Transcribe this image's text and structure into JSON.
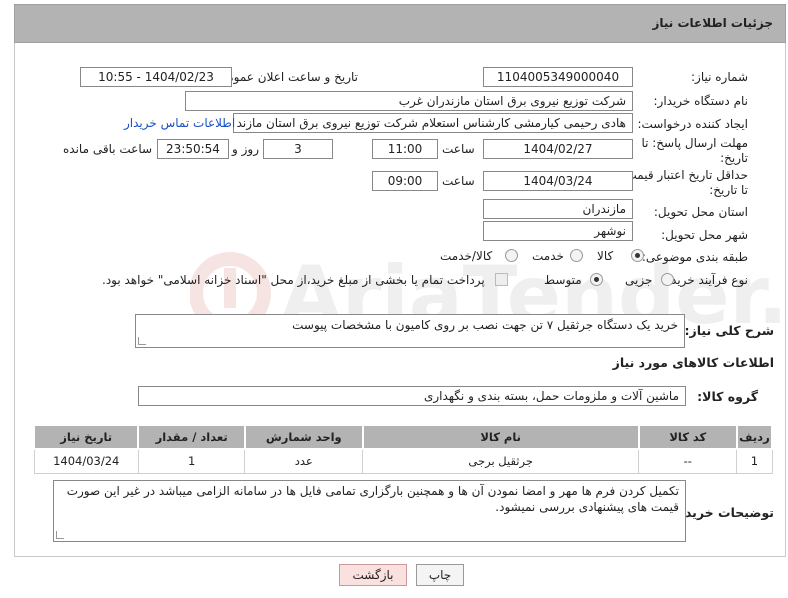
{
  "header": {
    "title": "جزئیات اطلاعات نیاز"
  },
  "form": {
    "need_number_label": "شماره نیاز:",
    "need_number": "1104005349000040",
    "announce_label": "تاریخ و ساعت اعلان عمومی:",
    "announce_value": "1404/02/23 - 10:55",
    "buyer_org_label": "نام دستگاه خریدار:",
    "buyer_org": "شرکت توزیع نیروی برق استان مازندران غرب",
    "creator_label": "ایجاد کننده درخواست:",
    "creator": "هادی رحیمی کیارمشی کارشناس استعلام شرکت توزیع نیروی برق استان مازند",
    "contact_link": "اطلاعات تماس خریدار",
    "deadline_label_1": "مهلت ارسال پاسخ: تا",
    "deadline_label_2": "تاریخ:",
    "deadline_date": "1404/02/27",
    "time_label": "ساعت",
    "deadline_time": "11:00",
    "days_value": "3",
    "days_label": "روز و",
    "remaining_time": "23:50:54",
    "remaining_label": "ساعت باقی مانده",
    "validity_label_1": "حداقل تاریخ اعتبار قیمت:",
    "validity_label_2": "تا تاریخ:",
    "validity_date": "1404/03/24",
    "validity_time_label": "ساعت",
    "validity_time": "09:00",
    "province_label": "استان محل تحویل:",
    "province": "مازندران",
    "city_label": "شهر محل تحویل:",
    "city": "نوشهر",
    "category_label": "طبقه بندی موضوعی:",
    "category_options": [
      "کالا",
      "خدمت",
      "کالا/خدمت"
    ],
    "category_selected": "کالا",
    "process_label": "نوع فرآیند خرید :",
    "process_options": [
      "جزیی",
      "متوسط"
    ],
    "process_selected": "متوسط",
    "payment_note": "پرداخت تمام یا بخشی از مبلغ خرید،از محل \"اسناد خزانه اسلامی\" خواهد بود."
  },
  "description": {
    "label": "شرح کلی نیاز:",
    "value": "خرید یک دستگاه جرثقیل ۷ تن جهت نصب بر روی کامیون با مشخصات پیوست"
  },
  "goods": {
    "section_title": "اطلاعات کالاهای مورد نیاز",
    "group_label": "گروه کالا:",
    "group_value": "ماشین آلات و ملزومات حمل، بسته بندی و نگهداری",
    "columns": [
      "ردیف",
      "کد کالا",
      "نام کالا",
      "واحد شمارش",
      "تعداد / مقدار",
      "تاریخ نیاز"
    ],
    "rows": [
      [
        "1",
        "--",
        "جرثقیل برجی",
        "عدد",
        "1",
        "1404/03/24"
      ]
    ]
  },
  "buyer_notes": {
    "label": "توضیحات خریدار:",
    "value": "تکمیل کردن فرم ها مهر و امضا نمودن آن ها و همچنین بارگزاری تمامی فایل ها در سامانه الزامی میباشد در غیر این صورت قیمت های پیشنهادی بررسی نمیشود."
  },
  "buttons": {
    "print": "چاپ",
    "back": "بازگشت"
  },
  "colors": {
    "header_bg": "#b3b3b3",
    "link": "#1a4fc4",
    "back_button_bg": "#fbe0e0"
  }
}
